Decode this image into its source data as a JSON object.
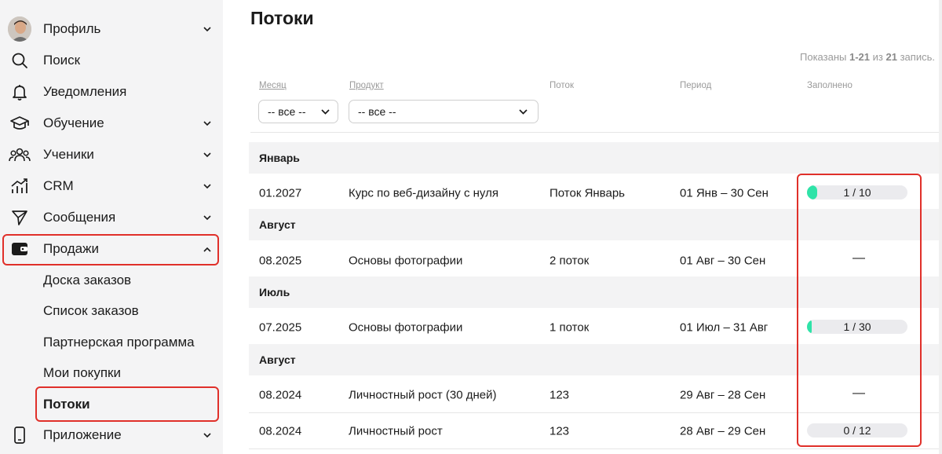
{
  "sidebar": {
    "items": [
      {
        "label": "Профиль",
        "icon": "avatar"
      },
      {
        "label": "Поиск",
        "icon": "search-icon"
      },
      {
        "label": "Уведомления",
        "icon": "bell-icon"
      },
      {
        "label": "Обучение",
        "icon": "graduation-cap-icon"
      },
      {
        "label": "Ученики",
        "icon": "users-icon"
      },
      {
        "label": "CRM",
        "icon": "chart-icon"
      },
      {
        "label": "Сообщения",
        "icon": "send-icon"
      },
      {
        "label": "Продажи",
        "icon": "wallet-icon"
      },
      {
        "label": "Приложение",
        "icon": "phone-icon"
      }
    ],
    "sales_sub": [
      {
        "label": "Доска заказов"
      },
      {
        "label": "Список заказов"
      },
      {
        "label": "Партнерская программа"
      },
      {
        "label": "Мои покупки"
      },
      {
        "label": "Потоки"
      }
    ]
  },
  "main": {
    "title": "Потоки",
    "shown": {
      "prefix": "Показаны",
      "range": "1-21",
      "middle": "из",
      "total": "21",
      "suffix": "запись."
    },
    "columns": {
      "month": "Месяц",
      "product": "Продукт",
      "stream": "Поток",
      "period": "Период",
      "filled": "Заполнено"
    },
    "filters": {
      "month_value": "-- все --",
      "product_value": "-- все --"
    },
    "groups": [
      "Январь",
      "Август",
      "Июль",
      "Август"
    ],
    "rows": [
      {
        "month": "01.2027",
        "product": "Курс по веб-дизайну с нуля",
        "stream": "Поток Январь",
        "period": "01 Янв – 30 Сен",
        "filled_text": "1 / 10",
        "filled_ratio": 0.1
      },
      {
        "month": "08.2025",
        "product": "Основы фотографии",
        "stream": "2 поток",
        "period": "01 Авг – 30 Сен",
        "filled_text": "—"
      },
      {
        "month": "07.2025",
        "product": "Основы фотографии",
        "stream": "1 поток",
        "period": "01 Июл – 31 Авг",
        "filled_text": "1 / 30",
        "filled_ratio": 0.0333
      },
      {
        "month": "08.2024",
        "product": "Личностный рост (30 дней)",
        "stream": "123",
        "period": "29 Авг – 28 Сен",
        "filled_text": "—"
      },
      {
        "month": "08.2024",
        "product": "Личностный рост",
        "stream": "123",
        "period": "28 Авг – 29 Сен",
        "filled_text": "0 / 12",
        "filled_ratio": 0
      }
    ]
  },
  "colors": {
    "highlight": "#e0302a",
    "progress_fill": "#2fe3a8",
    "sidebar_bg": "#f4f4f5",
    "group_bg": "#f3f3f4"
  }
}
